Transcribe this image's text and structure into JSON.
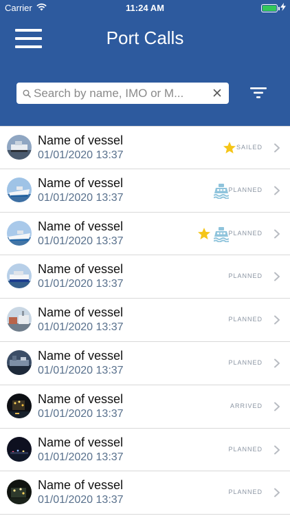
{
  "status_bar": {
    "carrier": "Carrier",
    "time": "11:24 AM",
    "wifi_icon": "wifi-icon",
    "battery_icon": "battery-icon",
    "charging_icon": "charging-bolt-icon",
    "battery_color": "#34c759"
  },
  "header": {
    "title": "Port Calls",
    "menu_icon": "hamburger-menu-icon",
    "filter_icon": "filter-icon",
    "background_color": "#2d5a9e"
  },
  "search": {
    "placeholder": "Search by name, IMO or M...",
    "value": "",
    "search_icon": "search-icon",
    "clear_icon": "clear-icon"
  },
  "vessels": [
    {
      "name": "Name of vessel",
      "datetime": "01/01/2020 13:37",
      "status": "SAILED",
      "favorite": true,
      "ferry": false
    },
    {
      "name": "Name of vessel",
      "datetime": "01/01/2020 13:37",
      "status": "PLANNED",
      "favorite": false,
      "ferry": true
    },
    {
      "name": "Name of vessel",
      "datetime": "01/01/2020 13:37",
      "status": "PLANNED",
      "favorite": true,
      "ferry": true
    },
    {
      "name": "Name of vessel",
      "datetime": "01/01/2020 13:37",
      "status": "PLANNED",
      "favorite": false,
      "ferry": false
    },
    {
      "name": "Name of vessel",
      "datetime": "01/01/2020 13:37",
      "status": "PLANNED",
      "favorite": false,
      "ferry": false
    },
    {
      "name": "Name of vessel",
      "datetime": "01/01/2020 13:37",
      "status": "PLANNED",
      "favorite": false,
      "ferry": false
    },
    {
      "name": "Name of vessel",
      "datetime": "01/01/2020 13:37",
      "status": "ARRIVED",
      "favorite": false,
      "ferry": false
    },
    {
      "name": "Name of vessel",
      "datetime": "01/01/2020 13:37",
      "status": "PLANNED",
      "favorite": false,
      "ferry": false
    },
    {
      "name": "Name of vessel",
      "datetime": "01/01/2020 13:37",
      "status": "PLANNED",
      "favorite": false,
      "ferry": false
    }
  ],
  "colors": {
    "star": "#f5c518",
    "ferry": "#8fc4dc",
    "date_text": "#58708c",
    "status_text": "#8a94a2"
  }
}
